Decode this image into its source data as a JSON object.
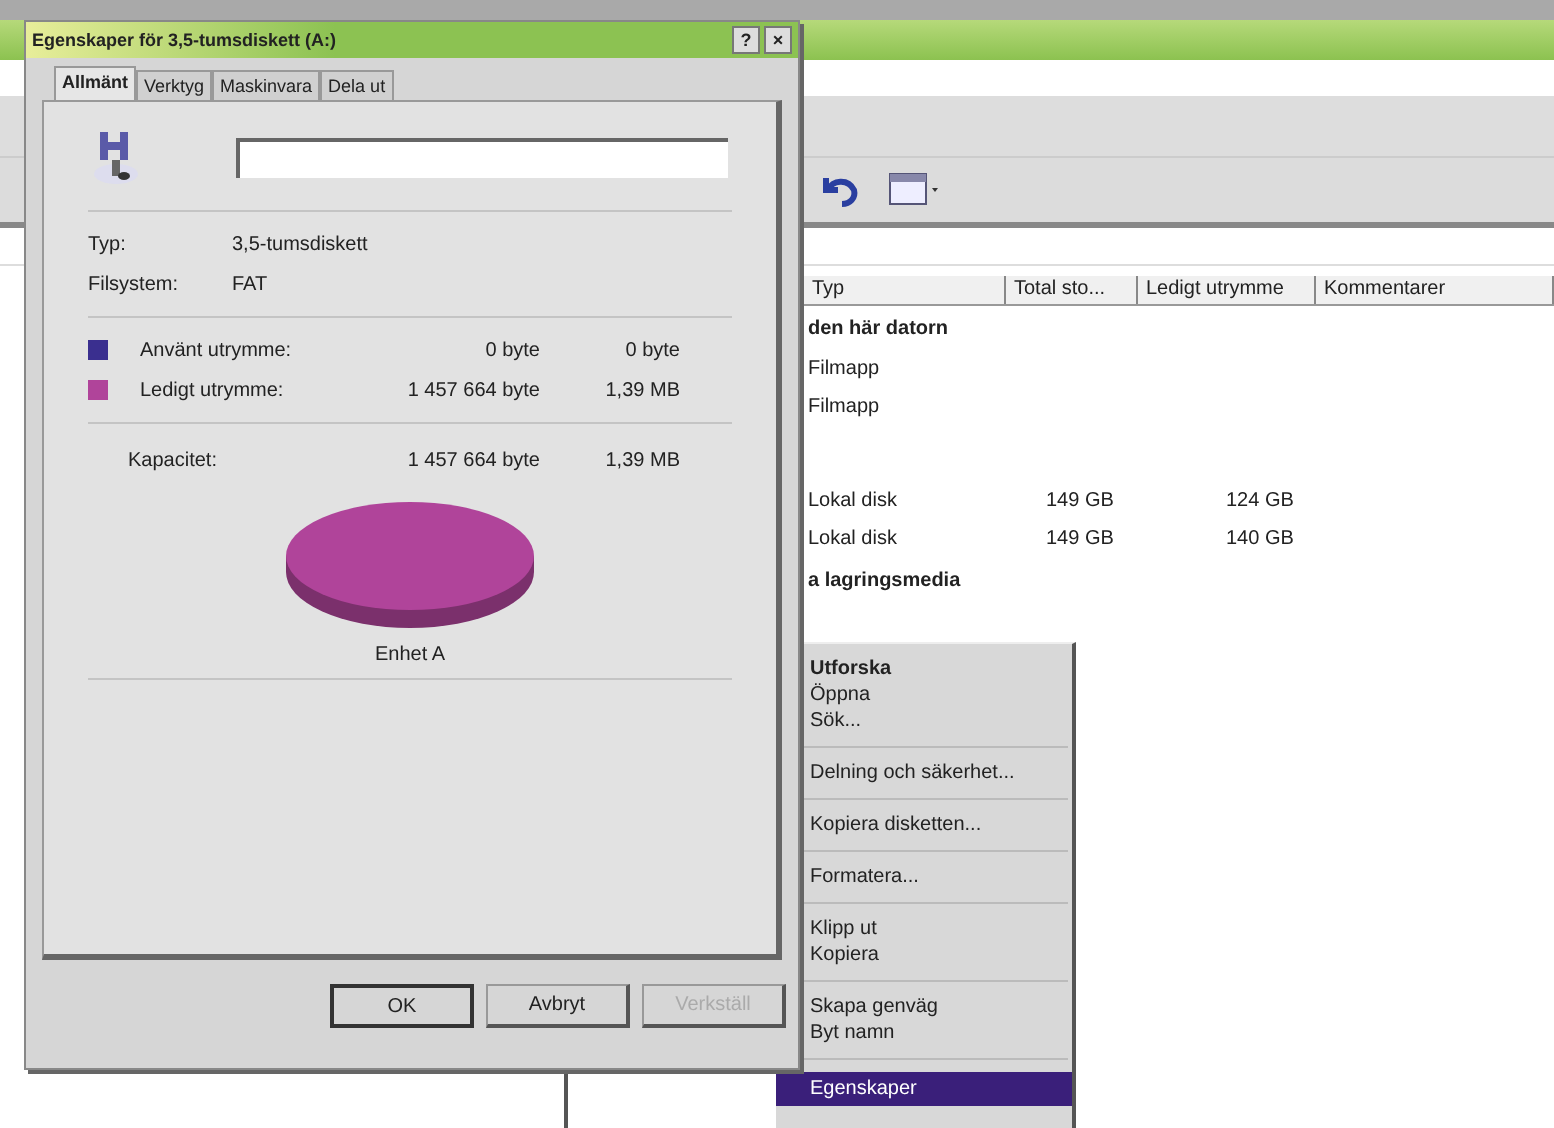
{
  "explorer": {
    "columns": [
      "Typ",
      "Total sto...",
      "Ledigt utrymme",
      "Kommentarer"
    ],
    "rows": [
      {
        "kind": "group",
        "cells": [
          "den här datorn"
        ]
      },
      {
        "kind": "row",
        "cells": [
          "Filmapp"
        ]
      },
      {
        "kind": "row",
        "cells": [
          "Filmapp"
        ]
      },
      {
        "kind": "blank",
        "cells": []
      },
      {
        "kind": "row",
        "cells": [
          "Lokal disk",
          "149 GB",
          "124 GB"
        ]
      },
      {
        "kind": "row",
        "cells": [
          "Lokal disk",
          "149 GB",
          "140 GB"
        ]
      },
      {
        "kind": "group",
        "cells": [
          "a lagringsmedia"
        ]
      }
    ]
  },
  "context_menu": [
    {
      "kind": "item",
      "label": "Utforska",
      "default": true,
      "selected": false
    },
    {
      "kind": "item",
      "label": "Öppna",
      "default": false,
      "selected": false
    },
    {
      "kind": "item",
      "label": "Sök...",
      "default": false,
      "selected": false
    },
    {
      "kind": "separator"
    },
    {
      "kind": "item",
      "label": "Delning och säkerhet...",
      "default": false,
      "selected": false
    },
    {
      "kind": "separator"
    },
    {
      "kind": "item",
      "label": "Kopiera disketten...",
      "default": false,
      "selected": false
    },
    {
      "kind": "separator"
    },
    {
      "kind": "item",
      "label": "Formatera...",
      "default": false,
      "selected": false
    },
    {
      "kind": "separator"
    },
    {
      "kind": "item",
      "label": "Klipp ut",
      "default": false,
      "selected": false
    },
    {
      "kind": "item",
      "label": "Kopiera",
      "default": false,
      "selected": false
    },
    {
      "kind": "separator"
    },
    {
      "kind": "item",
      "label": "Skapa genväg",
      "default": false,
      "selected": false
    },
    {
      "kind": "item",
      "label": "Byt namn",
      "default": false,
      "selected": false
    },
    {
      "kind": "separator"
    },
    {
      "kind": "item",
      "label": "Egenskaper",
      "default": false,
      "selected": true
    }
  ],
  "dialog": {
    "title": "Egenskaper för 3,5-tumsdiskett (A:)",
    "help": "?",
    "close": "×",
    "tabs": [
      {
        "label": "Allmänt",
        "selected": true
      },
      {
        "label": "Verktyg",
        "selected": false
      },
      {
        "label": "Maskinvara",
        "selected": false
      },
      {
        "label": "Dela ut",
        "selected": false
      }
    ],
    "info": [
      {
        "label": "Typ:",
        "value": "3,5-tumsdiskett"
      },
      {
        "label": "Filsystem:",
        "value": "FAT"
      }
    ],
    "usage": [
      {
        "label": "Använt utrymme:",
        "bytes": "0 byte",
        "size": "0 byte",
        "color": "#3a2f8f"
      },
      {
        "label": "Ledigt utrymme:",
        "bytes": "1 457 664 byte",
        "size": "1,39 MB",
        "color": "#b0449a"
      }
    ],
    "capacity": {
      "label": "Kapacitet:",
      "bytes": "1 457 664 byte",
      "size": "1,39 MB"
    },
    "drive_label": "Enhet A",
    "buttons": [
      {
        "label": "OK",
        "disabled": false
      },
      {
        "label": "Avbryt",
        "disabled": false
      },
      {
        "label": "Verkställ",
        "disabled": true
      }
    ]
  }
}
